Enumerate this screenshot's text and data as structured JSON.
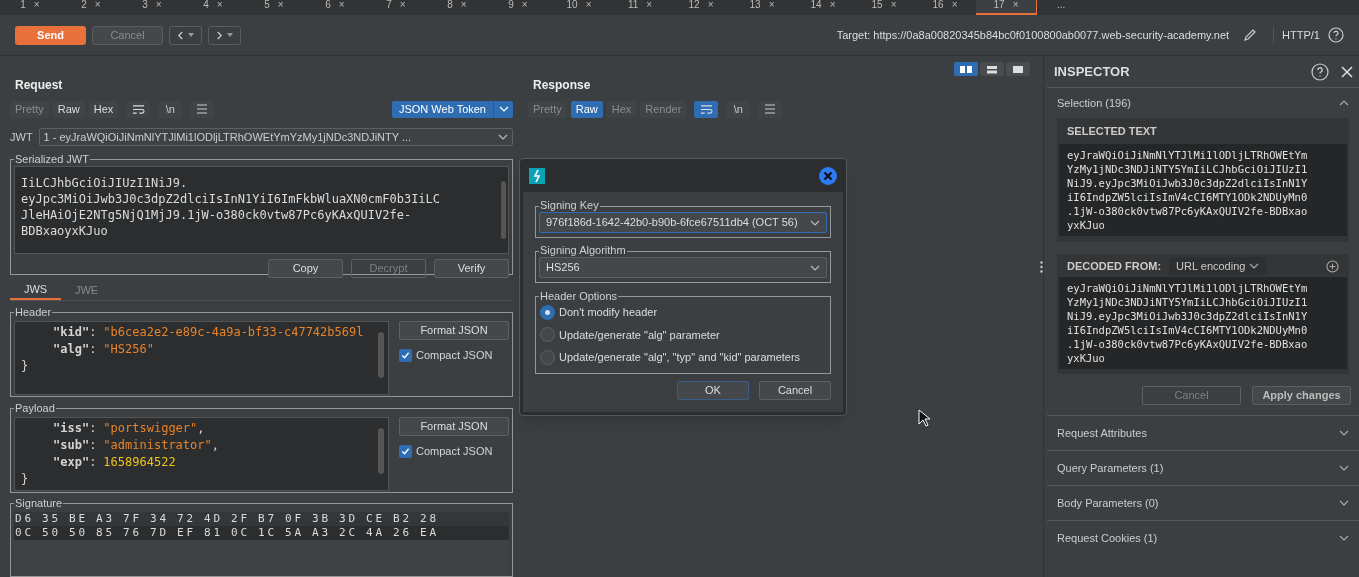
{
  "tabs": [
    {
      "label": "1",
      "close": "×",
      "selected": false
    },
    {
      "label": "2",
      "close": "×",
      "selected": false
    },
    {
      "label": "3",
      "close": "×",
      "selected": false
    },
    {
      "label": "4",
      "close": "×",
      "selected": false
    },
    {
      "label": "5",
      "close": "×",
      "selected": false
    },
    {
      "label": "6",
      "close": "×",
      "selected": false
    },
    {
      "label": "7",
      "close": "×",
      "selected": false
    },
    {
      "label": "8",
      "close": "×",
      "selected": false
    },
    {
      "label": "9",
      "close": "×",
      "selected": false
    },
    {
      "label": "10",
      "close": "×",
      "selected": false
    },
    {
      "label": "11",
      "close": "×",
      "selected": false
    },
    {
      "label": "12",
      "close": "×",
      "selected": false
    },
    {
      "label": "13",
      "close": "×",
      "selected": false
    },
    {
      "label": "14",
      "close": "×",
      "selected": false
    },
    {
      "label": "15",
      "close": "×",
      "selected": false
    },
    {
      "label": "16",
      "close": "×",
      "selected": false
    },
    {
      "label": "17",
      "close": "×",
      "selected": true
    }
  ],
  "tabs_more": "...",
  "toolbar": {
    "send": "Send",
    "cancel": {
      "label": "Cancel",
      "disabled": true
    },
    "target_label": "Target:",
    "target": "https://0a8a00820345b84bc0f0100800ab0077.web-security-academy.net",
    "protocol": "HTTP/1"
  },
  "layout_toggles": [
    {
      "kind": "columns",
      "selected": true
    },
    {
      "kind": "rows",
      "selected": false
    },
    {
      "kind": "single",
      "selected": false
    }
  ],
  "request": {
    "title": "Request",
    "views": [
      {
        "label": "Pretty",
        "selected": false,
        "disabled": true
      },
      {
        "label": "Raw",
        "selected": false,
        "disabled": false
      },
      {
        "label": "Hex",
        "selected": false,
        "disabled": false
      }
    ],
    "tools": [
      {
        "kind": "wrap",
        "selected": false
      },
      {
        "kind": "newline",
        "label": "\\n",
        "selected": false
      },
      {
        "kind": "menu",
        "selected": false
      }
    ],
    "extension_tab": "JSON Web Token",
    "jwt_label": "JWT",
    "jwt_select": "1 - eyJraWQiOiJiNmNlYTJlMi1lODljLTRhOWEtYmYzMy1jNDc3NDJiNTY ...",
    "serialized": {
      "title": "Serialized JWT",
      "lines": [
        "IiLCJhbGciOiJIUzI1NiJ9.",
        "eyJpc3MiOiJwb3J0c3dpZ2dlciIsInN1YiI6ImFkbWluaXN0cmF0b3IiLC",
        "JleHAiOjE2NTg5NjQ1MjJ9.1jW-o380ck0vtw87Pc6yKAxQUIV2fe-",
        "BDBxaoyxKJuo"
      ],
      "buttons": [
        {
          "label": "Copy",
          "disabled": false
        },
        {
          "label": "Decrypt",
          "disabled": true
        },
        {
          "label": "Verify",
          "disabled": false
        }
      ]
    },
    "jwt_tabs": [
      {
        "label": "JWS",
        "selected": true
      },
      {
        "label": "JWE",
        "selected": false
      }
    ],
    "sections": [
      {
        "title": "Header",
        "format": "Format JSON",
        "compact": {
          "label": "Compact JSON",
          "checked": true
        },
        "lines": [
          {
            "kind": "string",
            "key": "\"kid\"",
            "sep": ":",
            "value": "\"b6cea2e2-e89c-4a9a-bf33-c47742b569l"
          },
          {
            "kind": "string",
            "key": "\"alg\"",
            "sep": ":",
            "value": "\"HS256\""
          },
          {
            "kind": "brace",
            "text": "}"
          }
        ]
      },
      {
        "title": "Payload",
        "format": "Format JSON",
        "compact": {
          "label": "Compact JSON",
          "checked": true
        },
        "lines": [
          {
            "kind": "string",
            "key": "\"iss\"",
            "sep": ":",
            "value": "\"portswigger\"",
            "trail": ","
          },
          {
            "kind": "string",
            "key": "\"sub\"",
            "sep": ":",
            "value": "\"administrator\"",
            "trail": ","
          },
          {
            "kind": "number",
            "key": "\"exp\"",
            "sep": ":",
            "value": "1658964522"
          },
          {
            "kind": "brace",
            "text": "}"
          }
        ]
      }
    ],
    "signature": {
      "title": "Signature",
      "rows": [
        [
          "D6",
          "35",
          "BE",
          "A3",
          "7F",
          "34",
          "72",
          "4D",
          "2F",
          "B7",
          "0F",
          "3B",
          "3D",
          "CE",
          "B2",
          "28"
        ],
        [
          "0C",
          "50",
          "50",
          "85",
          "76",
          "7D",
          "EF",
          "81",
          "0C",
          "1C",
          "5A",
          "A3",
          "2C",
          "4A",
          "26",
          "EA"
        ]
      ]
    }
  },
  "response": {
    "title": "Response",
    "views": [
      {
        "label": "Pretty",
        "selected": false,
        "disabled": true
      },
      {
        "label": "Raw",
        "selected": true
      },
      {
        "label": "Hex",
        "selected": false,
        "disabled": true
      },
      {
        "label": "Render",
        "selected": false,
        "disabled": true
      }
    ],
    "tools": [
      {
        "kind": "wrap",
        "selected": true
      },
      {
        "kind": "newline",
        "label": "\\n",
        "selected": false
      },
      {
        "kind": "menu",
        "selected": false
      }
    ]
  },
  "dialog": {
    "signing_key": {
      "label": "Signing Key",
      "value": "976f186d-1642-42b0-b90b-6fce67511db4 (OCT 56)"
    },
    "algorithm": {
      "label": "Signing Algorithm",
      "value": "HS256"
    },
    "header_options": {
      "label": "Header Options",
      "options": [
        {
          "label": "Don't modify header",
          "selected": true
        },
        {
          "label": "Update/generate \"alg\" parameter",
          "selected": false
        },
        {
          "label": "Update/generate \"alg\", \"typ\" and \"kid\" parameters",
          "selected": false
        }
      ]
    },
    "ok": "OK",
    "cancel": "Cancel"
  },
  "inspector": {
    "title": "INSPECTOR",
    "selection": {
      "label": "Selection (196)",
      "expanded": true
    },
    "selected_text": {
      "title": "SELECTED TEXT",
      "lines": [
        "eyJraWQiOiJiNmNlYTJlMi1lODljLTRhOWEtYm",
        "YzMy1jNDc3NDJiNTY5YmIiLCJhbGciOiJIUzI1",
        "NiJ9.eyJpc3MiOiJwb3J0c3dpZ2dlciIsInN1Y",
        "iI6IndpZW5lciIsImV4cCI6MTY1ODk2NDUyMn0",
        ".1jW-o380ck0vtw87Pc6yKAxQUIV2fe-BDBxao",
        "yxKJuo"
      ]
    },
    "decoded": {
      "title": "DECODED FROM:",
      "encoding": "URL encoding",
      "lines": [
        "eyJraWQiOiJiNmNlYTJlMi1lODljLTRhOWEtYm",
        "YzMy1jNDc3NDJiNTY5YmIiLCJhbGciOiJIUzI1",
        "NiJ9.eyJpc3MiOiJwb3J0c3dpZ2dlciIsInN1Y",
        "iI6IndpZW5lciIsImV4cCI6MTY1ODk2NDUyMn0",
        ".1jW-o380ck0vtw87Pc6yKAxQUIV2fe-BDBxao",
        "yxKJuo"
      ]
    },
    "buttons": [
      "Cancel",
      "Apply changes"
    ],
    "sections": [
      {
        "label": "Request Attributes",
        "expanded": false
      },
      {
        "label": "Query Parameters (1)",
        "expanded": false
      },
      {
        "label": "Body Parameters (0)",
        "expanded": false
      },
      {
        "label": "Request Cookies (1)",
        "expanded": false
      }
    ]
  }
}
